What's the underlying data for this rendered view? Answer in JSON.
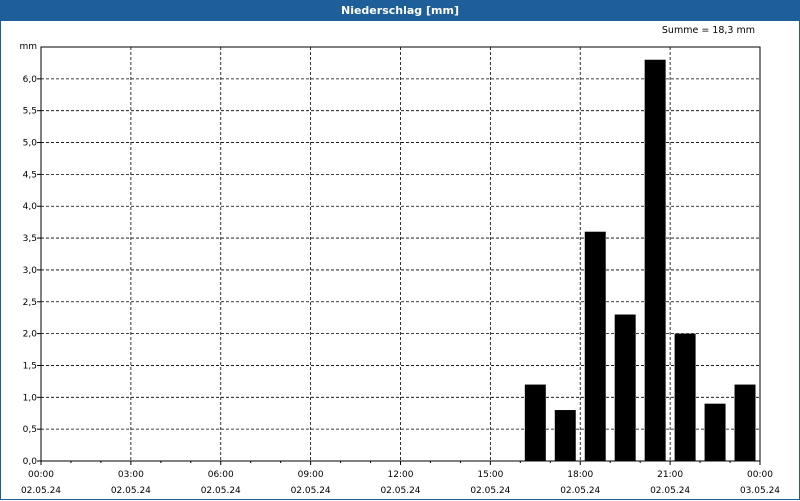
{
  "title": "Niederschlag [mm]",
  "summary": "Summe = 18,3 mm",
  "chart_data": {
    "type": "bar",
    "title": "Niederschlag [mm]",
    "ylabel": "mm",
    "xlabel": "",
    "ylim": [
      0,
      6.5
    ],
    "y_ticks": [
      "0,0",
      "0,5",
      "1,0",
      "1,5",
      "2,0",
      "2,5",
      "3,0",
      "3,5",
      "4,0",
      "4,5",
      "5,0",
      "5,5",
      "6,0"
    ],
    "x_ticks": [
      {
        "time": "00:00",
        "date": "02.05.24"
      },
      {
        "time": "03:00",
        "date": "02.05.24"
      },
      {
        "time": "06:00",
        "date": "02.05.24"
      },
      {
        "time": "09:00",
        "date": "02.05.24"
      },
      {
        "time": "12:00",
        "date": "02.05.24"
      },
      {
        "time": "15:00",
        "date": "02.05.24"
      },
      {
        "time": "18:00",
        "date": "02.05.24"
      },
      {
        "time": "21:00",
        "date": "02.05.24"
      },
      {
        "time": "00:00",
        "date": "03.05.24"
      }
    ],
    "xlim_hours": [
      0,
      24
    ],
    "bars": [
      {
        "hour": 16.5,
        "value": 1.2
      },
      {
        "hour": 17.5,
        "value": 0.8
      },
      {
        "hour": 18.5,
        "value": 3.6
      },
      {
        "hour": 19.5,
        "value": 2.3
      },
      {
        "hour": 20.5,
        "value": 6.3
      },
      {
        "hour": 21.5,
        "value": 2.0
      },
      {
        "hour": 22.5,
        "value": 0.9
      },
      {
        "hour": 23.5,
        "value": 1.2
      }
    ],
    "bar_color": "#000000",
    "grid": true,
    "grid_style": "dashed"
  }
}
